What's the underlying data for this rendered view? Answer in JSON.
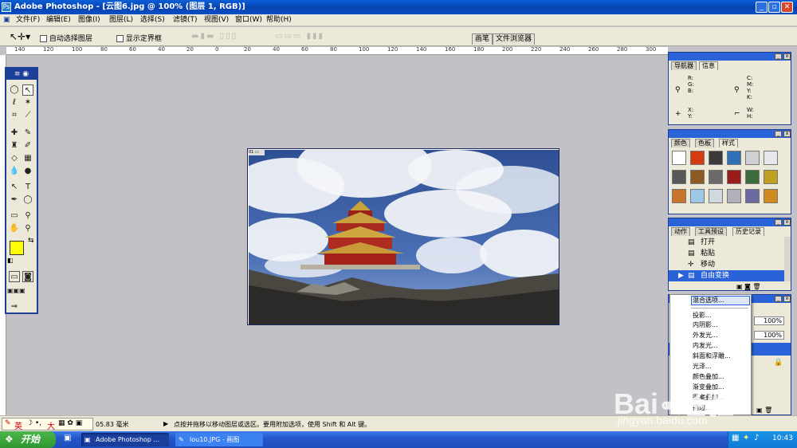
{
  "window": {
    "title": "Adobe Photoshop - [云图6.jpg @ 100% (图层 1, RGB)]",
    "controls": {
      "minimize": "_",
      "restore": "▫",
      "close": "✕"
    }
  },
  "menu": [
    "文件(F)",
    "编辑(E)",
    "图像(I)",
    "图层(L)",
    "选择(S)",
    "滤镜(T)",
    "视图(V)",
    "窗口(W)",
    "帮助(H)"
  ],
  "options": {
    "auto_select": "自动选择图层",
    "show_bounds": "显示定界框",
    "palette_tabs": [
      "画笔",
      "文件浏览器"
    ]
  },
  "ruler": [
    "140",
    "120",
    "100",
    "80",
    "60",
    "40",
    "20",
    "0",
    "20",
    "40",
    "60",
    "80",
    "100",
    "120",
    "140",
    "160",
    "180",
    "200",
    "220",
    "240",
    "260",
    "280",
    "300"
  ],
  "colors": {
    "foreground": "#ffff00",
    "background": "#0000d8"
  },
  "navigator": {
    "tabs": [
      "导航器",
      "信息"
    ],
    "rgb": [
      "R:",
      "G:",
      "B:"
    ],
    "cmyk": [
      "C:",
      "M:",
      "Y:",
      "K:"
    ],
    "xy": [
      "X:",
      "Y:"
    ],
    "wh": [
      "W:",
      "H:"
    ]
  },
  "swatches": {
    "tabs": [
      "颜色",
      "色板",
      "样式"
    ],
    "styles": [
      "#ffffff",
      "#d83a10",
      "#3a3a3a",
      "#2f6fb7",
      "#cfd0d2",
      "#e5e7ea",
      "#585858",
      "#8c5a22",
      "#6a6a6a",
      "#9c1b1b",
      "#3b6a3b",
      "#c0a020",
      "#c8742c",
      "#9ec8e8",
      "#d0d8e0",
      "#b0b0b8",
      "#6a6aa0",
      "#d08a20"
    ]
  },
  "history": {
    "tabs": [
      "动作",
      "工具预设",
      "历史记录"
    ],
    "items": [
      "打开",
      "粘贴",
      "移动",
      "自由变换"
    ]
  },
  "layers": {
    "fields": [
      "正",
      "100%",
      "锁",
      "100%"
    ]
  },
  "context_menu": [
    "混合选项...",
    "投影...",
    "内阴影...",
    "外发光...",
    "内发光...",
    "斜面和浮雕...",
    "光泽...",
    "颜色叠加...",
    "渐变叠加...",
    "图案叠加...",
    "描边..."
  ],
  "status": {
    "ime": "英",
    "ime_mode": "大",
    "size": "05.83 毫米",
    "hint": "点按并拖移以移动图层或选区。要用附加选项，使用 Shift 和 Alt 键。"
  },
  "taskbar": {
    "start": "开始",
    "tasks": [
      "Adobe Photoshop ...",
      "lou10.JPG - 画图"
    ],
    "clock": "10:43"
  },
  "watermark": "jingyan.baidu.com"
}
